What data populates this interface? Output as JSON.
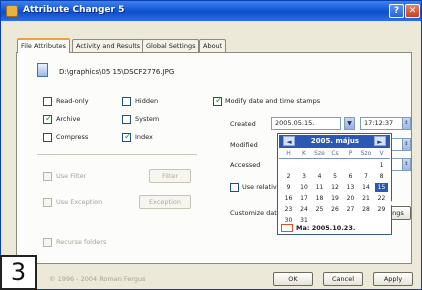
{
  "window": {
    "title": "Attribute Changer 5",
    "help_glyph": "?",
    "close_glyph": "✕"
  },
  "tabs": [
    {
      "label": "File Attributes"
    },
    {
      "label": "Activity and Results"
    },
    {
      "label": "Global Settings"
    },
    {
      "label": "About"
    }
  ],
  "file": {
    "path": "D:\\graphics\\05 15\\DSCF2776.JPG"
  },
  "attributes": {
    "readonly": {
      "label": "Read-only",
      "checked": false
    },
    "hidden": {
      "label": "Hidden",
      "checked": false
    },
    "archive": {
      "label": "Archive",
      "checked": true
    },
    "system": {
      "label": "System",
      "checked": false
    },
    "compress": {
      "label": "Compress",
      "checked": false
    },
    "index": {
      "label": "Index",
      "checked": true
    }
  },
  "left_options": {
    "use_filter": {
      "label": "Use Filter",
      "checked": false
    },
    "filter_button": "Filter",
    "use_exception": {
      "label": "Use Exception",
      "checked": false
    },
    "exception_button": "Exception",
    "recurse": {
      "label": "Recurse folders",
      "checked": false
    }
  },
  "timestamps": {
    "modify": {
      "label": "Modify date and time stamps",
      "checked": true
    },
    "created_label": "Created",
    "created_date": "2005.05.15.",
    "created_time": "17:12:37",
    "modified_label": "Modified",
    "accessed_label": "Accessed",
    "use_relative_label": "Use relative",
    "customize_label": "Customize date",
    "settings_button": "ngs"
  },
  "calendar": {
    "title": "2005. május",
    "prev": "◄",
    "next": "►",
    "weekdays": [
      "H",
      "K",
      "Sze",
      "Cs",
      "P",
      "Szo",
      "V"
    ],
    "weeks": [
      [
        "",
        "",
        "",
        "",
        "",
        "",
        "1"
      ],
      [
        "2",
        "3",
        "4",
        "5",
        "6",
        "7",
        "8"
      ],
      [
        "9",
        "10",
        "11",
        "12",
        "13",
        "14",
        "15"
      ],
      [
        "16",
        "17",
        "18",
        "19",
        "20",
        "21",
        "22"
      ],
      [
        "23",
        "24",
        "25",
        "26",
        "27",
        "28",
        "29"
      ],
      [
        "30",
        "31",
        "",
        "",
        "",
        "",
        ""
      ]
    ],
    "selected_day": "15",
    "today_label": "Ma: 2005.10.23."
  },
  "footer": {
    "copyright": "© 1996 - 2004 Roman Fergus",
    "ok": "OK",
    "cancel": "Cancel",
    "apply": "Apply"
  },
  "badge": "3",
  "colors": {
    "titlebar": "#1657d9",
    "calendar_header": "#2b58b3",
    "check": "#21a121"
  }
}
